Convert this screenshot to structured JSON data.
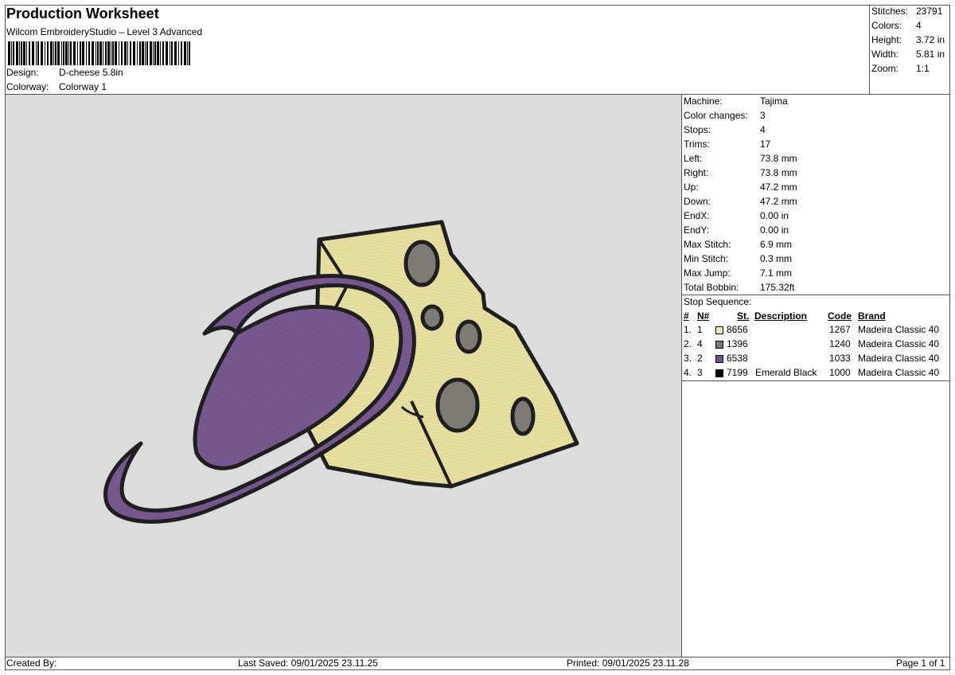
{
  "header": {
    "title": "Production Worksheet",
    "subtitle": "Wilcom EmbroideryStudio – Level 3 Advanced",
    "design_label": "Design:",
    "design_value": "D-cheese 5.8in",
    "colorway_label": "Colorway:",
    "colorway_value": "Colorway 1"
  },
  "stats": [
    {
      "label": "Stitches:",
      "value": "23791"
    },
    {
      "label": "Colors:",
      "value": "4"
    },
    {
      "label": "Height:",
      "value": "3.72 in"
    },
    {
      "label": "Width:",
      "value": "5.81 in"
    },
    {
      "label": "Zoom:",
      "value": "1:1"
    }
  ],
  "machine_info": [
    {
      "label": "Machine:",
      "value": "Tajima"
    },
    {
      "label": "Color changes:",
      "value": "3"
    },
    {
      "label": "Stops:",
      "value": "4"
    },
    {
      "label": "Trims:",
      "value": "17"
    },
    {
      "label": "Left:",
      "value": "73.8 mm"
    },
    {
      "label": "Right:",
      "value": "73.8 mm"
    },
    {
      "label": "Up:",
      "value": "47.2 mm"
    },
    {
      "label": "Down:",
      "value": "47.2 mm"
    },
    {
      "label": "EndX:",
      "value": "0.00 in"
    },
    {
      "label": "EndY:",
      "value": "0.00 in"
    },
    {
      "label": "Max Stitch:",
      "value": "6.9 mm"
    },
    {
      "label": "Min Stitch:",
      "value": "0.3 mm"
    },
    {
      "label": "Max Jump:",
      "value": "7.1 mm"
    },
    {
      "label": "Total Bobbin:",
      "value": "175.32ft"
    }
  ],
  "stop_sequence": {
    "title": "Stop Sequence:",
    "columns": {
      "hash": "#",
      "n": "N#",
      "st": "St.",
      "description": "Description",
      "code": "Code",
      "brand": "Brand"
    },
    "rows": [
      {
        "num": "1.",
        "n": "1",
        "color": "#f0e6b4",
        "st": "8656",
        "description": "",
        "code": "1267",
        "brand": "Madeira Classic 40"
      },
      {
        "num": "2.",
        "n": "4",
        "color": "#7a7873",
        "st": "1396",
        "description": "",
        "code": "1240",
        "brand": "Madeira Classic 40"
      },
      {
        "num": "3.",
        "n": "2",
        "color": "#6e5390",
        "st": "6538",
        "description": "",
        "code": "1033",
        "brand": "Madeira Classic 40"
      },
      {
        "num": "4.",
        "n": "3",
        "color": "#000000",
        "st": "7199",
        "description": "Emerald Black",
        "code": "1000",
        "brand": "Madeira Classic 40"
      }
    ]
  },
  "footer": {
    "created_by": "Created By:",
    "last_saved": "Last Saved: 09/01/2025 23.11.25",
    "printed": "Printed: 09/01/2025 23.11.28",
    "page": "Page 1 of 1"
  },
  "design_colors": {
    "background": "#dcdcdc",
    "cheese": "#e6dfa0",
    "purple": "#77598f",
    "hole_gray": "#7d7b74",
    "outline": "#1f1f1f"
  }
}
